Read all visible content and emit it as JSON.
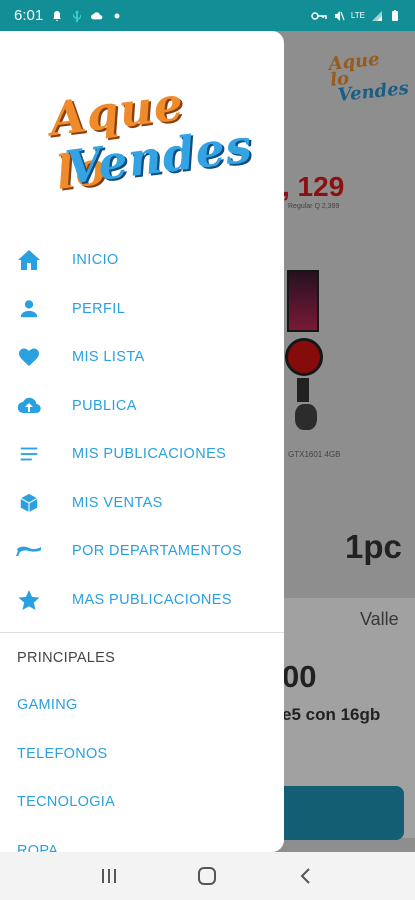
{
  "status_bar": {
    "time": "6:01",
    "left_icons": [
      "notification-icon",
      "usb-icon",
      "cloud-icon",
      "dot-icon"
    ],
    "right_icons": [
      "vpn-key-icon",
      "mute-icon",
      "lte-signal-icon",
      "signal-icon",
      "battery-icon"
    ],
    "lte_label": "LTE"
  },
  "drawer": {
    "logo": {
      "line1": "Aque lo",
      "line2": "Vendes"
    },
    "menu": [
      {
        "label": "INICIO",
        "icon": "home-icon"
      },
      {
        "label": "PERFIL",
        "icon": "person-icon"
      },
      {
        "label": "MIS LISTA",
        "icon": "heart-icon"
      },
      {
        "label": "PUBLICA",
        "icon": "cloud-upload-icon"
      },
      {
        "label": "MIS PUBLICACIONES",
        "icon": "list-icon"
      },
      {
        "label": "MIS VENTAS",
        "icon": "box-icon"
      },
      {
        "label": "POR DEPARTAMENTOS",
        "icon": "flag-icon"
      },
      {
        "label": "MAS PUBLICACIONES",
        "icon": "star-icon"
      }
    ],
    "section_title": "PRINCIPALES",
    "categories": [
      "GAMING",
      "TELEFONOS",
      "TECNOLOGIA",
      "ROPA"
    ]
  },
  "background": {
    "logo": {
      "line1": "Aque lo",
      "line2": "Vendes"
    },
    "price": ", 129",
    "regular_price": "Regular Q 2,399",
    "product_caption": "GTX1601 4GB",
    "title": "1pc",
    "card_location": "Valle",
    "card_price": "00",
    "card_desc": "e5 con 16gb"
  },
  "colors": {
    "accent": "#29a0e0",
    "status_bar": "#128f96",
    "logo_orange": "#f08b2b",
    "logo_blue": "#34a3e3"
  },
  "nav_bar": {
    "buttons": [
      "recent-apps-icon",
      "home-circle-icon",
      "back-icon"
    ]
  }
}
